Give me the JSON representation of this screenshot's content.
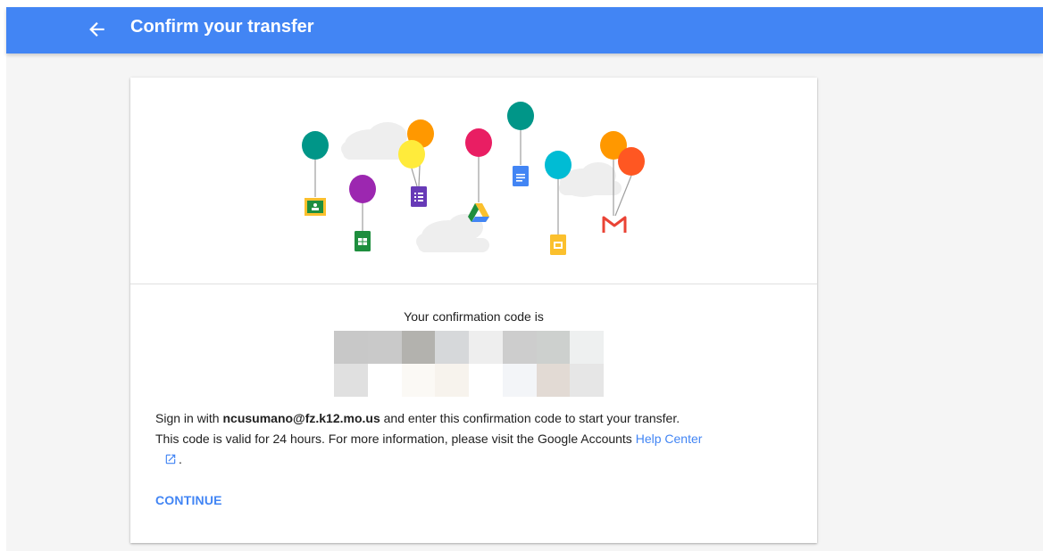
{
  "header": {
    "title": "Confirm your transfer"
  },
  "confirmation": {
    "label": "Your confirmation code is",
    "pixel_colors": [
      "#c8c8c8",
      "#c9c9c9",
      "#b3b2ae",
      "#d6d8da",
      "#eeeeee",
      "#cdcdcd",
      "#cdd0ce",
      "#eef0f0",
      "#e0e0e0",
      "#ffffff",
      "#fbf9f5",
      "#f7f3ed",
      "#ffffff",
      "#f3f5f8",
      "#e2dad4",
      "#e6e6e6"
    ]
  },
  "instructions": {
    "line1_prefix": "Sign in with",
    "email": "ncusumano@fz.k12.mo.us",
    "line1_suffix": "and enter this confirmation code to start your transfer.",
    "line2_prefix": "This code is valid for 24 hours. For more information, please visit the Google Accounts",
    "help_link": "Help Center",
    "trailing": "."
  },
  "actions": {
    "continue_label": "CONTINUE"
  },
  "colors": {
    "header_bg": "#4285f4",
    "accent": "#4285f4",
    "page_bg": "#f5f5f5"
  },
  "icons": {
    "back": "arrow-left-icon",
    "external": "open-in-new-icon"
  }
}
